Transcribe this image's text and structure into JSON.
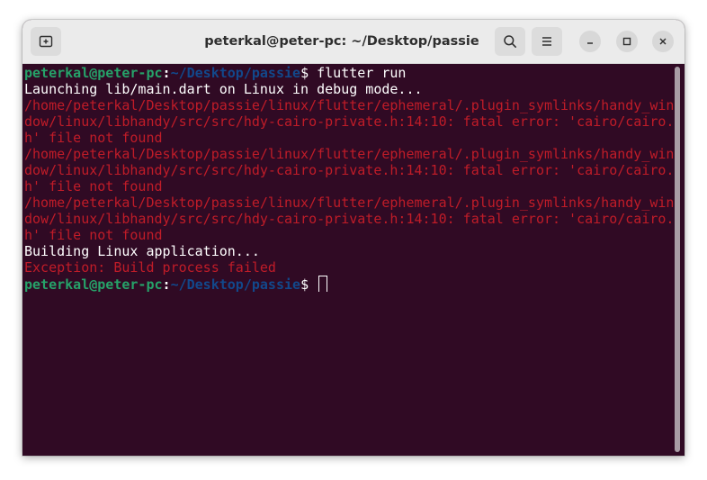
{
  "window": {
    "title": "peterkal@peter-pc: ~/Desktop/passie",
    "controls": {
      "new_tab_icon": "new-tab-icon",
      "search_icon": "search-icon",
      "menu_icon": "hamburger-menu-icon",
      "minimize_icon": "minimize-icon",
      "maximize_icon": "maximize-icon",
      "close_icon": "close-icon"
    }
  },
  "terminal": {
    "prompt1": {
      "user": "peterkal@peter-pc",
      "sep": ":",
      "path": "~/Desktop/passie",
      "symbol": "$ ",
      "command": "flutter run"
    },
    "output": [
      {
        "text": "Launching lib/main.dart on Linux in debug mode...",
        "kind": "normal"
      },
      {
        "text": "/home/peterkal/Desktop/passie/linux/flutter/ephemeral/.plugin_symlinks/handy_win",
        "kind": "error"
      },
      {
        "text": "dow/linux/libhandy/src/src/hdy-cairo-private.h:14:10: fatal error: 'cairo/cairo.",
        "kind": "error"
      },
      {
        "text": "h' file not found",
        "kind": "error"
      },
      {
        "text": "/home/peterkal/Desktop/passie/linux/flutter/ephemeral/.plugin_symlinks/handy_win",
        "kind": "error"
      },
      {
        "text": "dow/linux/libhandy/src/src/hdy-cairo-private.h:14:10: fatal error: 'cairo/cairo.",
        "kind": "error"
      },
      {
        "text": "h' file not found",
        "kind": "error"
      },
      {
        "text": "/home/peterkal/Desktop/passie/linux/flutter/ephemeral/.plugin_symlinks/handy_win",
        "kind": "error"
      },
      {
        "text": "dow/linux/libhandy/src/src/hdy-cairo-private.h:14:10: fatal error: 'cairo/cairo.",
        "kind": "error"
      },
      {
        "text": "h' file not found",
        "kind": "error"
      },
      {
        "text": "Building Linux application...",
        "kind": "normal"
      },
      {
        "text": "Exception: Build process failed",
        "kind": "error"
      }
    ],
    "prompt2": {
      "user": "peterkal@peter-pc",
      "sep": ":",
      "path": "~/Desktop/passie",
      "symbol": "$ ",
      "command": ""
    }
  },
  "colors": {
    "background": "#300a24",
    "prompt_user": "#26a269",
    "prompt_path": "#12488b",
    "error_text": "#c01c28",
    "titlebar": "#ebebeb"
  }
}
